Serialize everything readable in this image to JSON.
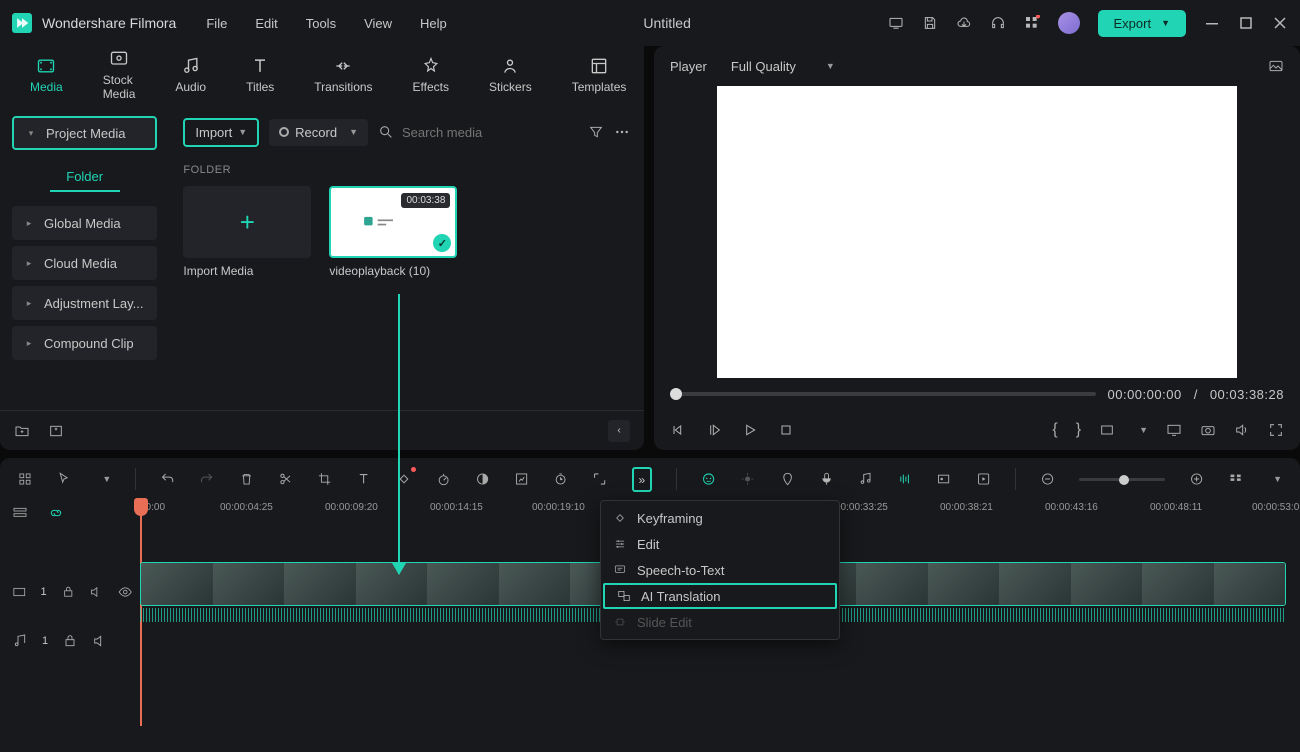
{
  "app": {
    "name": "Wondershare Filmora",
    "document": "Untitled"
  },
  "menus": [
    "File",
    "Edit",
    "Tools",
    "View",
    "Help"
  ],
  "export_label": "Export",
  "tabs": [
    {
      "label": "Media"
    },
    {
      "label": "Stock Media"
    },
    {
      "label": "Audio"
    },
    {
      "label": "Titles"
    },
    {
      "label": "Transitions"
    },
    {
      "label": "Effects"
    },
    {
      "label": "Stickers"
    },
    {
      "label": "Templates"
    }
  ],
  "sidebar": {
    "project": "Project Media",
    "folder": "Folder",
    "items": [
      "Global Media",
      "Cloud Media",
      "Adjustment Lay...",
      "Compound Clip"
    ]
  },
  "media_toolbar": {
    "import": "Import",
    "record": "Record",
    "search_placeholder": "Search media"
  },
  "folder_header": "FOLDER",
  "thumbs": {
    "import_label": "Import Media",
    "clip_name": "videoplayback (10)",
    "clip_duration": "00:03:38"
  },
  "player": {
    "title": "Player",
    "quality": "Full Quality",
    "current": "00:00:00:00",
    "sep": "/",
    "total": "00:03:38:28"
  },
  "ruler": [
    "00:00",
    "00:00:04:25",
    "00:00:09:20",
    "00:00:14:15",
    "00:00:19:10",
    "00:00:33:25",
    "00:00:38:21",
    "00:00:43:16",
    "00:00:48:11",
    "00:00:53:0"
  ],
  "popup": {
    "keyframing": "Keyframing",
    "edit": "Edit",
    "stt": "Speech-to-Text",
    "ai_translation": "AI Translation",
    "slide_edit": "Slide Edit"
  },
  "tracks": {
    "v1": "1",
    "a1": "1"
  }
}
